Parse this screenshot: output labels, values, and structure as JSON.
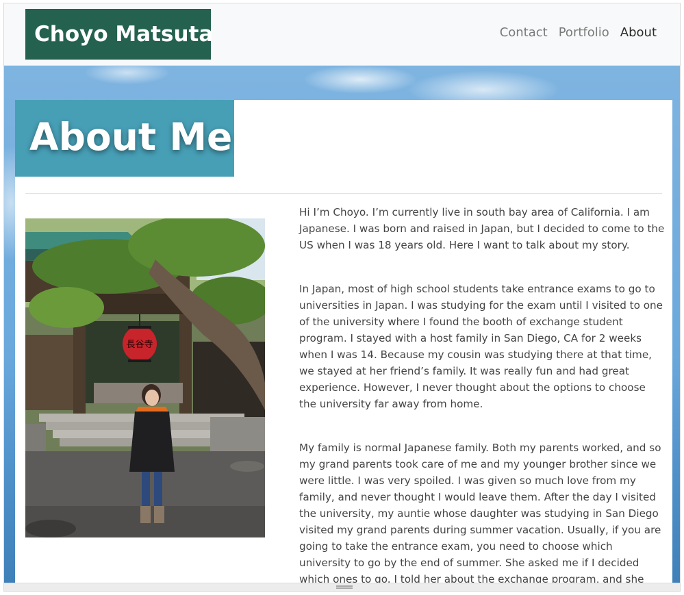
{
  "site": {
    "brand": "Choyo Matsuta"
  },
  "nav": {
    "items": [
      {
        "label": "Contact",
        "active": false
      },
      {
        "label": "Portfolio",
        "active": false
      },
      {
        "label": "About",
        "active": true
      }
    ]
  },
  "about": {
    "title": "About Me",
    "paragraphs": [
      "Hi I’m Choyo. I’m currently live in south bay area of California. I am Japanese. I was born and raised in Japan, but I decided to come to the US when I was 18 years old. Here I want to talk about my story.",
      "In Japan, most of high school students take entrance exams to go to universities in Japan. I was studying for the exam until I visited to one of the university where I found the booth of exchange student program. I stayed with a host family in San Diego, CA for 2 weeks when I was 14. Because my cousin was studying there at that time, we stayed at her friend’s family. It was really fun and had great experience. However, I never thought about the options to choose the university far away from home.",
      "My family is normal Japanese family. Both my parents worked, and so my grand parents took care of me and my younger brother since we were little. I was very spoiled. I was given so much love from my family, and never thought I would leave them. After the day I visited the university, my auntie whose daughter was studying in San Diego visited my grand parents during summer vacation. Usually, if you are going to take the entrance exam, you need to choose which university to go by the end of summer. She asked me if I decided which ones to go. I told her about the exchange program, and she"
    ]
  },
  "photo": {
    "lantern_text": "長谷寺"
  },
  "colors": {
    "brand_bg": "#24614f",
    "title_bg": "#479fb6",
    "sky": "#6aa8dc"
  }
}
